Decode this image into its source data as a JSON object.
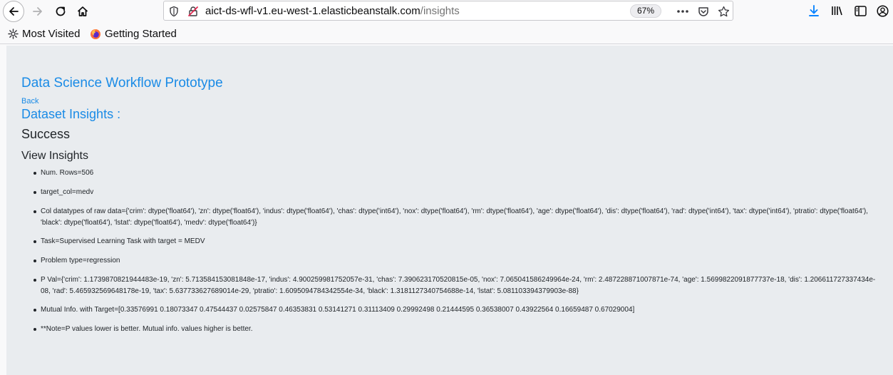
{
  "browser": {
    "url_host": "aict-ds-wfl-v1.eu-west-1.elasticbeanstalk.com",
    "url_path": "/insights",
    "zoom": "67%",
    "bookmarks": [
      "Most Visited",
      "Getting Started"
    ]
  },
  "icons": {
    "back": "back-arrow-icon",
    "forward": "forward-arrow-icon",
    "reload": "reload-icon",
    "home": "home-icon",
    "tracking": "shield-icon",
    "insecure": "insecure-lock-icon",
    "more": "more-actions-icon",
    "pocket": "pocket-icon",
    "bookmark": "star-icon",
    "downloads": "download-icon",
    "library": "library-icon",
    "sidebar": "sidebar-icon",
    "account": "account-icon",
    "most_visited": "gear-icon",
    "getting_started": "firefox-icon"
  },
  "page": {
    "title": "Data Science Workflow Prototype",
    "back_link": "Back",
    "dataset_heading": "Dataset Insights :",
    "status": "Success",
    "section_heading": "View Insights",
    "insights": [
      "Num. Rows=506",
      "target_col=medv",
      "Col datatypes of raw data={'crim': dtype('float64'), 'zn': dtype('float64'), 'indus': dtype('float64'), 'chas': dtype('int64'), 'nox': dtype('float64'), 'rm': dtype('float64'), 'age': dtype('float64'), 'dis': dtype('float64'), 'rad': dtype('int64'), 'tax': dtype('int64'), 'ptratio': dtype('float64'), 'black': dtype('float64'), 'lstat': dtype('float64'), 'medv': dtype('float64')}",
      "Task=Supervised Learning Task with target = MEDV",
      "Problem type=regression",
      "P Val={'crim': 1.1739870821944483e-19, 'zn': 5.713584153081848e-17, 'indus': 4.900259981752057e-31, 'chas': 7.390623170520815e-05, 'nox': 7.065041586249964e-24, 'rm': 2.487228871007871e-74, 'age': 1.5699822091877737e-18, 'dis': 1.206611727337434e-08, 'rad': 5.465932569648178e-19, 'tax': 5.637733627689014e-29, 'ptratio': 1.6095094784342554e-34, 'black': 1.3181127340754688e-14, 'lstat': 5.081103394379903e-88}",
      "Mutual Info. with Target=[0.33576991 0.18073347 0.47544437 0.02575847 0.46353831 0.53141271 0.31113409 0.29992498 0.21444595 0.36538007 0.43922564 0.16659487 0.67029004]",
      "**Note=P values lower is better. Mutual info. values higher is better."
    ]
  }
}
